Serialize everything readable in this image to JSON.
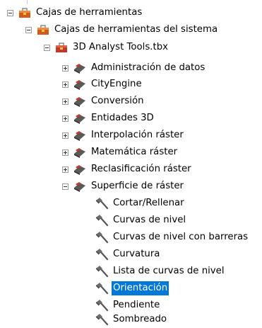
{
  "tree": {
    "root": {
      "label": "Cajas de herramientas",
      "expanded": true,
      "icon": "toolbox-icon"
    },
    "system": {
      "label": "Cajas de herramientas del sistema",
      "expanded": true,
      "icon": "toolbox-icon"
    },
    "analyst": {
      "label": "3D Analyst Tools.tbx",
      "expanded": true,
      "icon": "toolbox-icon"
    },
    "toolsets": [
      {
        "label": "Administración de datos",
        "expanded": false,
        "icon": "toolset-icon"
      },
      {
        "label": "CityEngine",
        "expanded": false,
        "icon": "toolset-icon"
      },
      {
        "label": "Conversión",
        "expanded": false,
        "icon": "toolset-icon"
      },
      {
        "label": "Entidades 3D",
        "expanded": false,
        "icon": "toolset-icon"
      },
      {
        "label": "Interpolación ráster",
        "expanded": false,
        "icon": "toolset-icon"
      },
      {
        "label": "Matemática ráster",
        "expanded": false,
        "icon": "toolset-icon"
      },
      {
        "label": "Reclasificación ráster",
        "expanded": false,
        "icon": "toolset-icon"
      },
      {
        "label": "Superficie de ráster",
        "expanded": true,
        "icon": "toolset-icon"
      }
    ],
    "tools": [
      {
        "label": "Cortar/Rellenar",
        "icon": "hammer-icon"
      },
      {
        "label": "Curvas de nivel",
        "icon": "hammer-icon"
      },
      {
        "label": "Curvas de nivel con barreras",
        "icon": "hammer-icon"
      },
      {
        "label": "Curvatura",
        "icon": "hammer-icon"
      },
      {
        "label": "Lista de curvas de nivel",
        "icon": "hammer-icon"
      },
      {
        "label": "Orientación",
        "icon": "hammer-icon",
        "selected": true
      },
      {
        "label": "Pendiente",
        "icon": "hammer-icon"
      },
      {
        "label": "Sombreado",
        "icon": "hammer-icon"
      }
    ],
    "selection_color": "#0078d7"
  }
}
